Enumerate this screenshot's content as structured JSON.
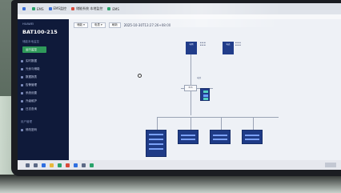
{
  "browser": {
    "tabs": [
      {
        "label": "",
        "icon": "gear-icon"
      },
      {
        "label": "EMS",
        "icon": "app-icon"
      },
      {
        "label": "EMS监控",
        "icon": "app-icon"
      },
      {
        "label": "储能系统 本地监控",
        "icon": "app-icon"
      },
      {
        "label": "EMS",
        "icon": "app-icon"
      }
    ]
  },
  "sidebar": {
    "brand": "HUAWEI",
    "device": "BAT100-215",
    "subtitle": "储能本地监控",
    "active_item": "运行监控",
    "items": [
      {
        "label": "实时数据"
      },
      {
        "label": "光伏与储能"
      },
      {
        "label": "数据报表"
      },
      {
        "label": "告警管理"
      },
      {
        "label": "系统设置"
      },
      {
        "label": "升级维护"
      },
      {
        "label": "日志查询"
      }
    ],
    "footer_group": "用户管理",
    "footer_item": "修改密码"
  },
  "toolbar": {
    "select1": "储能 ▾",
    "select2": "电表 ▾",
    "select3": "刷新",
    "datetime": "2025-10-30T13:27:26+08:00"
  },
  "diagram": {
    "grid_label": "电网",
    "meter_label": "电表",
    "pcs_label": "PCS",
    "battery_label": "电池",
    "panels": [
      "储能柜",
      "PCS",
      "PCS",
      "PCS"
    ]
  },
  "colors": {
    "sidebar_bg": "#0f1a3a",
    "accent_green": "#2f9a5a",
    "node_blue": "#213d8a"
  }
}
